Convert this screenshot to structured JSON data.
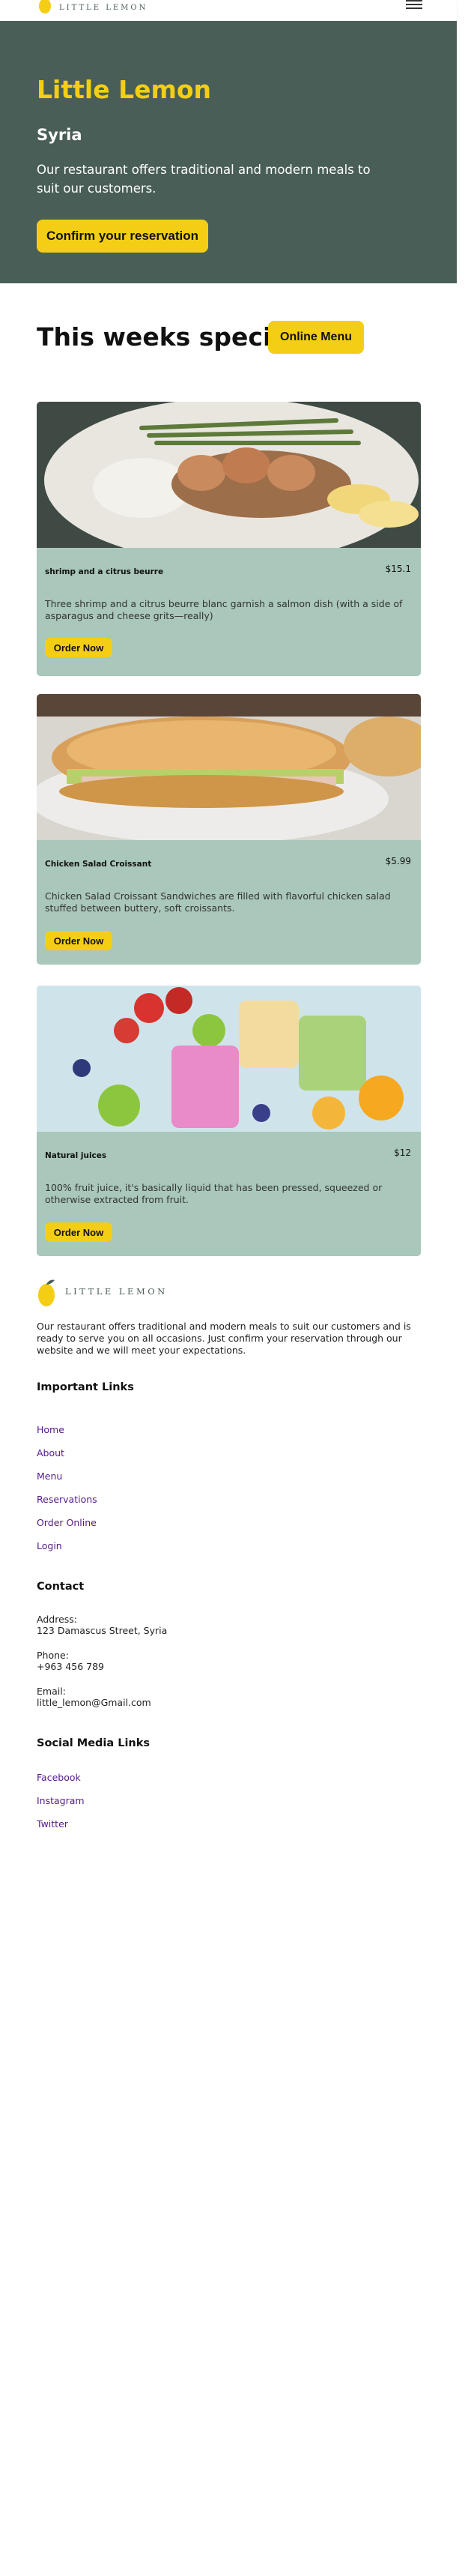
{
  "nav": {
    "logo_text": "LITTLE LEMON",
    "menu_icon": "hamburger-icon"
  },
  "hero": {
    "title": "Little Lemon",
    "city": "Syria",
    "description": "Our restaurant offers traditional and modern meals to suit our customers.",
    "button": "Confirm your reservation"
  },
  "specials": {
    "title": "This weeks specials!",
    "menu_button": "Online Menu",
    "items": [
      {
        "name": "shrimp and a citrus beurre",
        "price": "$15.1",
        "description": "Three shrimp and a citrus beurre blanc garnish a salmon dish (with a side of asparagus and cheese grits—really)",
        "button": "Order Now"
      },
      {
        "name": "Chicken Salad Croissant",
        "price": "$5.99",
        "description": "Chicken Salad Croissant Sandwiches are filled with flavorful chicken salad stuffed between buttery, soft croissants.",
        "button": "Order Now"
      },
      {
        "name": "Natural juices",
        "price": "$12",
        "description": "100% fruit juice, it's basically liquid that has been pressed, squeezed or otherwise extracted from fruit.",
        "button": "Order Now"
      }
    ]
  },
  "footer": {
    "logo_text": "LITTLE LEMON",
    "about": "Our restaurant offers traditional and modern meals to suit our customers and is ready to serve you on all occasions. Just confirm your reservation through our website and we will meet your expectations.",
    "links_heading": "Important Links",
    "links": [
      "Home",
      "About",
      "Menu",
      "Reservations",
      "Order Online",
      "Login"
    ],
    "contact_heading": "Contact",
    "address_label": "Address:",
    "address": "123 Damascus Street, Syria",
    "phone_label": "Phone:",
    "phone": "+963 456 789",
    "email_label": "Email:",
    "email": "little_lemon@Gmail.com",
    "social_heading": "Social Media Links",
    "social": [
      "Facebook",
      "Instagram",
      "Twitter"
    ]
  },
  "colors": {
    "primary_green": "#495e57",
    "primary_yellow": "#f4ce14",
    "card_bg": "#a9c7ba",
    "link": "#551a8b"
  }
}
